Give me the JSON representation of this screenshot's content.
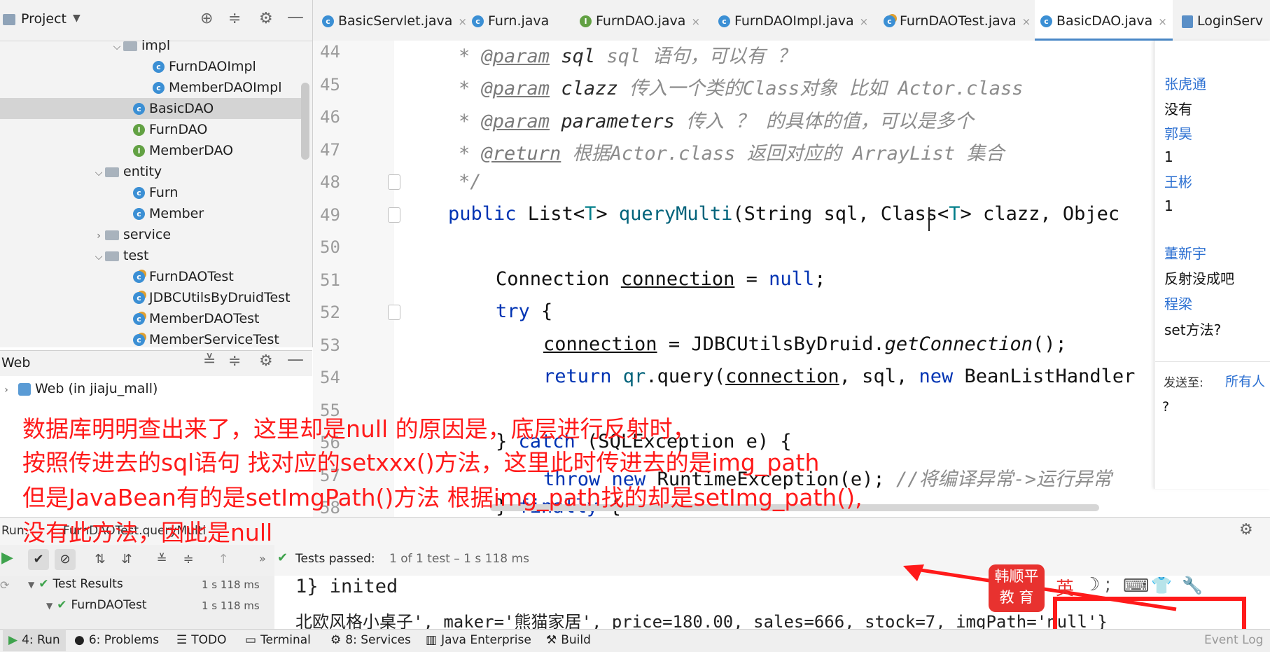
{
  "project": {
    "title": "Project",
    "tree": [
      {
        "label": "impl",
        "kind": "folder",
        "expanded": true
      },
      {
        "label": "FurnDAOImpl",
        "kind": "class"
      },
      {
        "label": "MemberDAOImpl",
        "kind": "class"
      },
      {
        "label": "BasicDAO",
        "kind": "class",
        "selected": true
      },
      {
        "label": "FurnDAO",
        "kind": "interface"
      },
      {
        "label": "MemberDAO",
        "kind": "interface"
      },
      {
        "label": "entity",
        "kind": "folder",
        "expanded": true
      },
      {
        "label": "Furn",
        "kind": "class"
      },
      {
        "label": "Member",
        "kind": "class"
      },
      {
        "label": "service",
        "kind": "folder",
        "expanded": false
      },
      {
        "label": "test",
        "kind": "folder",
        "expanded": true
      },
      {
        "label": "FurnDAOTest",
        "kind": "test"
      },
      {
        "label": "JDBCUtilsByDruidTest",
        "kind": "test"
      },
      {
        "label": "MemberDAOTest",
        "kind": "test"
      },
      {
        "label": "MemberServiceTest",
        "kind": "test"
      }
    ]
  },
  "web": {
    "title": "Web",
    "item": "Web (in jiaju_mall)"
  },
  "tabs": [
    {
      "label": "BasicServlet.java",
      "icon": "class",
      "close": "×"
    },
    {
      "label": "Furn.java",
      "icon": "class",
      "close": ""
    },
    {
      "label": "FurnDAO.java",
      "icon": "interface",
      "close": "×"
    },
    {
      "label": "FurnDAOImpl.java",
      "icon": "class",
      "close": "×"
    },
    {
      "label": "FurnDAOTest.java",
      "icon": "test",
      "close": "×"
    },
    {
      "label": "BasicDAO.java",
      "icon": "class",
      "close": "×",
      "active": true
    },
    {
      "label": "LoginServ",
      "icon": "file",
      "close": ""
    }
  ],
  "editor": {
    "line_numbers": [
      "44",
      "45",
      "46",
      "47",
      "48",
      "49",
      "50",
      "51",
      "52",
      "53",
      "54",
      "55",
      "56",
      "57",
      "58"
    ],
    "lines": {
      "l44": {
        "star": "* ",
        "tag": "@param",
        "p": " sql",
        "desc": " sql 语句，可以有 ？"
      },
      "l45": {
        "star": "* ",
        "tag": "@param",
        "p": " clazz",
        "desc": " 传入一个类的Class对象 比如 Actor.class"
      },
      "l46": {
        "star": "* ",
        "tag": "@param",
        "p": " parameters",
        "desc": " 传入 ？ 的具体的值，可以是多个"
      },
      "l47": {
        "star": "* ",
        "tag": "@return",
        "desc": " 根据Actor.class 返回对应的 ArrayList 集合"
      },
      "l48": "*/",
      "l49": {
        "a": "public ",
        "b": "List<",
        "c": "T",
        "d": "> ",
        "e": "queryMulti",
        "f": "(String sql, Class<",
        "g": "T",
        "h": "> clazz, Objec"
      },
      "l51": {
        "a": "Connection ",
        "b": "connection",
        "c": " = ",
        "d": "null",
        "e": ";"
      },
      "l52": {
        "a": "try",
        "b": " {"
      },
      "l53": {
        "a": "connection",
        "b": " = JDBCUtilsByDruid.",
        "c": "getConnection",
        "d": "();"
      },
      "l54": {
        "a": "return ",
        "b": "qr",
        "c": ".query(",
        "d": "connection",
        "e": ", sql, ",
        "f": "new",
        "g": " BeanListHandler"
      },
      "l56": {
        "a": "} ",
        "b": "catch",
        "c": " (SQLException e) {"
      },
      "l57": {
        "a": "throw ",
        "b": "new",
        "c": " RuntimeException(e);",
        "d": " //将编译异常->运行异常"
      },
      "l58": {
        "a": "} ",
        "b": "finally",
        "c": " {"
      }
    }
  },
  "chat": {
    "entries": [
      {
        "type": "name",
        "text": "张虎通"
      },
      {
        "type": "msg",
        "text": "没有"
      },
      {
        "type": "name",
        "text": "郭昊"
      },
      {
        "type": "msg",
        "text": "1"
      },
      {
        "type": "name",
        "text": "王彬"
      },
      {
        "type": "msg",
        "text": "1"
      },
      {
        "type": "name",
        "text": "董新宇"
      },
      {
        "type": "msg",
        "text": "反射没成吧"
      },
      {
        "type": "name",
        "text": "程梁"
      },
      {
        "type": "msg",
        "text": "set方法?"
      }
    ],
    "send_to_label": "发送至:",
    "send_to_value": "所有人",
    "input_text": "?"
  },
  "annotation": {
    "lines": [
      "数据库明明查出来了，这里却是null 的原因是，底层进行反射时，",
      "按照传进去的sql语句 找对应的setxxx()方法，这里此时传进去的是img_path",
      "但是JavaBean有的是setImgPath()方法 根据img_path找的却是setImg_path(),",
      "没有此方法，因此是null"
    ],
    "color": "#ff1a1a"
  },
  "run": {
    "label": "Run:",
    "config": "FurnDAOTest.queryMulti",
    "tests_passed": "Tests passed:",
    "tests_count": "1 of 1 test – 1 s 118 ms",
    "results": [
      {
        "label": "Test Results",
        "time": "1 s 118 ms"
      },
      {
        "label": "FurnDAOTest",
        "time": "1 s 118 ms"
      }
    ],
    "console_line1": "1} inited",
    "console_line2": "北欧风格小桌子', maker='熊猫家居', price=180.00, sales=666, stock=7, imgPath='null'}"
  },
  "watermark": {
    "line1": "韩顺平",
    "line2": "教 育",
    "color": "#e8322f"
  },
  "statusbar": {
    "items": [
      "4: Run",
      "6: Problems",
      "TODO",
      "Terminal",
      "8: Services",
      "Java Enterprise",
      "Build",
      "Event Log"
    ]
  }
}
